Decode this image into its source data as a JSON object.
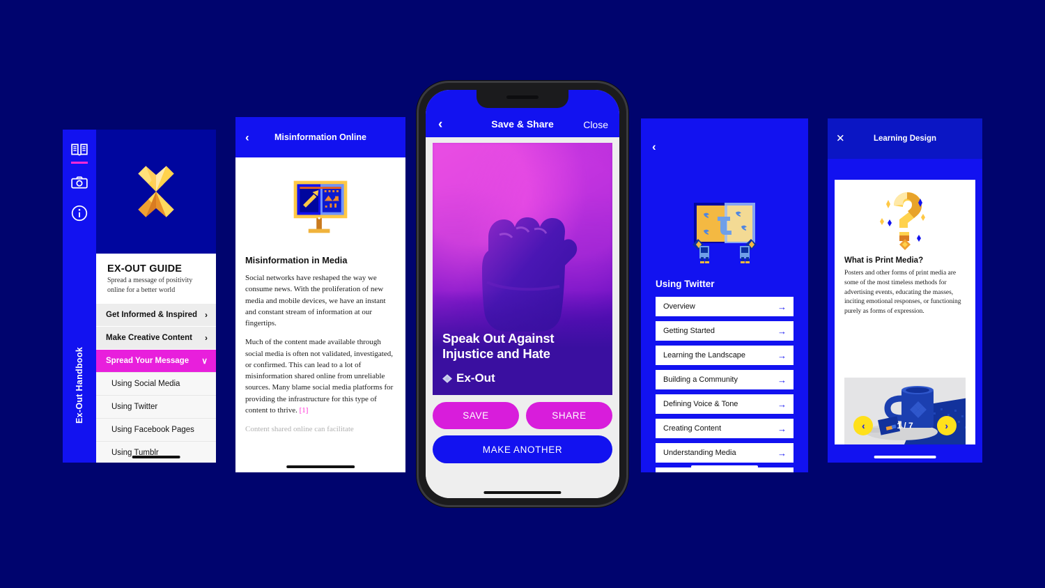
{
  "background_color": "#00046e",
  "brand_blue": "#1212f0",
  "accent_pink": "#e81fdc",
  "accent_yellow": "#ffe01b",
  "panel1": {
    "rail": {
      "icons": [
        "book-icon",
        "camera-icon",
        "info-icon"
      ],
      "vertical_label": "Ex-Out  Handbook",
      "vertical_label_mark": "❦"
    },
    "logo": "ex-out-x-logo",
    "title": "EX-OUT GUIDE",
    "subtitle": "Spread a message of positivity online for a better world",
    "items": [
      {
        "label": "Get Informed & Inspired",
        "chevron": "›",
        "selected": false
      },
      {
        "label": "Make Creative Content",
        "chevron": "›",
        "selected": false
      },
      {
        "label": "Spread Your Message",
        "chevron": "∨",
        "selected": true
      }
    ],
    "sub_items": [
      {
        "label": "Using Social Media"
      },
      {
        "label": "Using Twitter"
      },
      {
        "label": "Using Facebook Pages"
      },
      {
        "label": "Using Tumblr"
      }
    ]
  },
  "panel2": {
    "header": {
      "title": "Misinformation Online",
      "back": "‹"
    },
    "illustration": "billboard-megaphone-icon",
    "heading": "Misinformation in Media",
    "paragraph1": "Social networks have reshaped the way we consume news. With the proliferation of new media and mobile devices, we have an instant and constant stream of information at our fingertips.",
    "paragraph2_text": "Much of the content made available through social media is often not validated, investigated, or confirmed. This can lead to a lot of misinformation shared online from unreliable sources. Many blame social media platforms for providing the infrastructure for this type of content to thrive.",
    "paragraph2_ref": "[1]"
  },
  "phone": {
    "header": {
      "back": "‹",
      "title": "Save & Share",
      "close": "Close"
    },
    "poster": {
      "image": "raised-fist-photo",
      "headline": "Speak Out Against Injustice and Hate",
      "brand": "Ex-Out",
      "brand_mark": "❦"
    },
    "buttons": {
      "save": "SAVE",
      "share": "SHARE",
      "make_another": "MAKE ANOTHER"
    }
  },
  "panel4": {
    "back": "‹",
    "illustration": "twitter-banner-characters-icon",
    "heading": "Using Twitter",
    "rows": [
      {
        "label": "Overview",
        "arrow": "→"
      },
      {
        "label": "Getting Started",
        "arrow": "→"
      },
      {
        "label": "Learning the Landscape",
        "arrow": "→"
      },
      {
        "label": "Building a Community",
        "arrow": "→"
      },
      {
        "label": "Defining Voice & Tone",
        "arrow": "→"
      },
      {
        "label": "Creating Content",
        "arrow": "→"
      },
      {
        "label": "Understanding Media",
        "arrow": "→"
      }
    ]
  },
  "panel5": {
    "header": {
      "close": "✕",
      "title": "Learning Design"
    },
    "illustration": "question-mark-icon",
    "heading": "What is Print Media?",
    "paragraph": "Posters and other forms of print media are some of the most timeless methods for advertising events, educating the masses, inciting emotional responses, or functioning purely as forms of expression.",
    "photo": "blue-mug-merch-photo",
    "carousel": {
      "prev": "‹",
      "next": "›",
      "pager": "1 / 7"
    }
  }
}
